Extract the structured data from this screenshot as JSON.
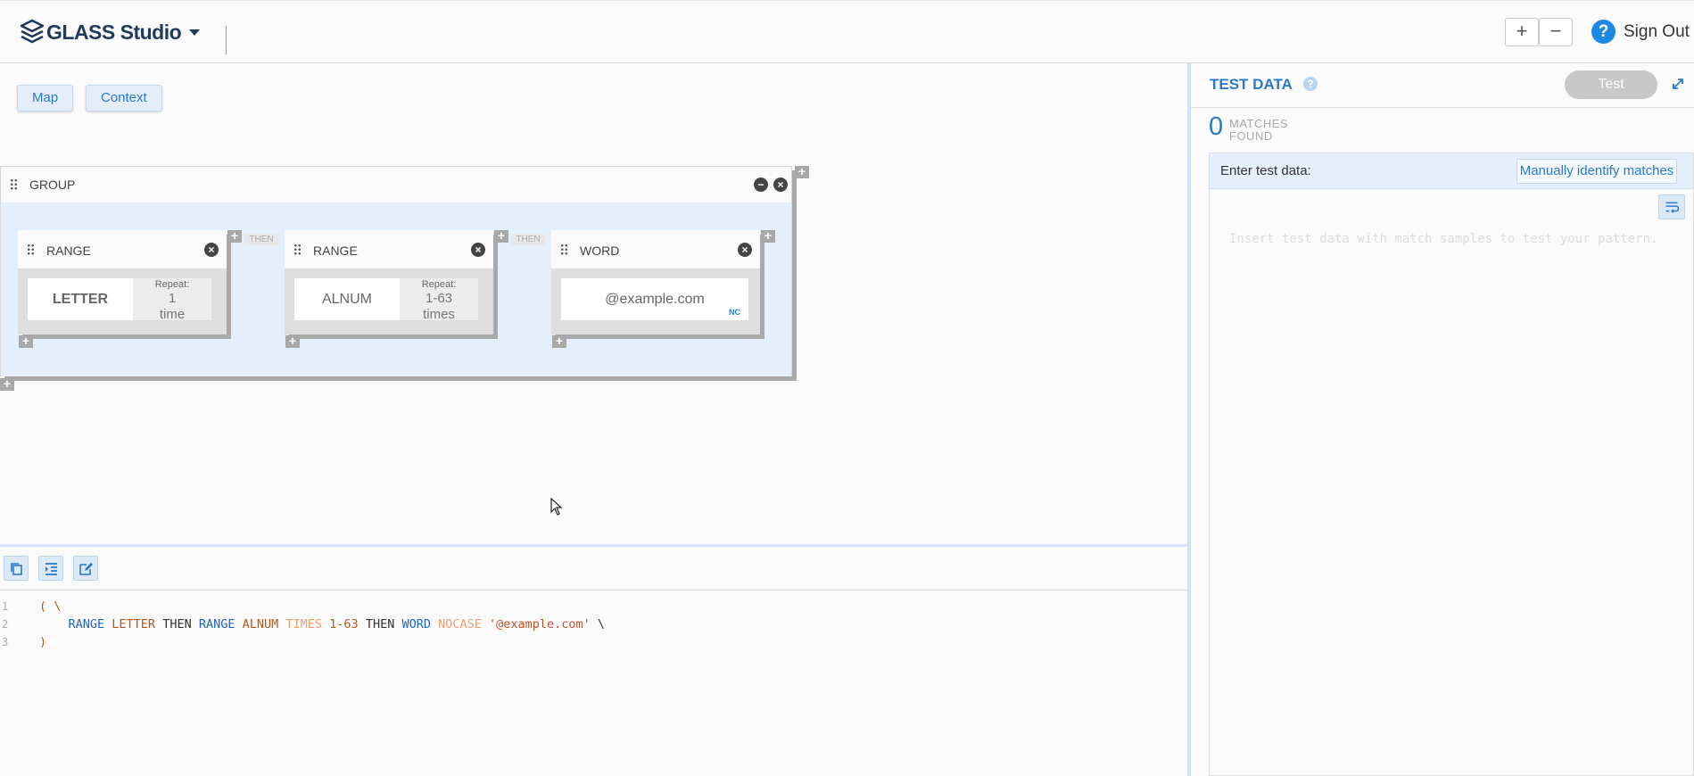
{
  "app": {
    "brand_name": "GLASS Studio",
    "zoom_in_label": "+",
    "zoom_out_label": "−",
    "help_label": "?",
    "sign_out_label": "Sign Out"
  },
  "canvas_toolbar": {
    "map_label": "Map",
    "context_label": "Context"
  },
  "pattern": {
    "group": {
      "label": "GROUP"
    },
    "nodes": [
      {
        "type": "RANGE",
        "value": "LETTER",
        "repeat_label": "Repeat:",
        "repeat_value": "1 time"
      },
      {
        "type": "RANGE",
        "value": "ALNUM",
        "repeat_label": "Repeat:",
        "repeat_value": "1-63 times"
      },
      {
        "type": "WORD",
        "value": "@example.com",
        "flag": "NC"
      }
    ],
    "connector_label": "THEN"
  },
  "code": {
    "lines": [
      {
        "num": "1",
        "tokens": [
          {
            "t": "( \\",
            "c": "kw-or"
          }
        ]
      },
      {
        "num": "2",
        "tokens": [
          {
            "t": "    RANGE ",
            "c": "kw-blue"
          },
          {
            "t": "LETTER ",
            "c": "kw-or"
          },
          {
            "t": "THEN ",
            "c": "kw-dark"
          },
          {
            "t": "RANGE ",
            "c": "kw-blue"
          },
          {
            "t": "ALNUM ",
            "c": "kw-or"
          },
          {
            "t": "TIMES ",
            "c": "kw-light"
          },
          {
            "t": "1-63 ",
            "c": "kw-or"
          },
          {
            "t": "THEN ",
            "c": "kw-dark"
          },
          {
            "t": "WORD ",
            "c": "kw-blue"
          },
          {
            "t": "NOCASE ",
            "c": "kw-light"
          },
          {
            "t": "'@example.com' ",
            "c": "kw-str"
          },
          {
            "t": "\\",
            "c": "kw-dark"
          }
        ]
      },
      {
        "num": "3",
        "tokens": [
          {
            "t": ")",
            "c": "kw-or"
          }
        ]
      }
    ]
  },
  "test_data": {
    "title": "TEST DATA",
    "test_button": "Test",
    "matches_count": "0",
    "matches_line1": "MATCHES",
    "matches_line2": "FOUND",
    "enter_label": "Enter test data:",
    "manual_button": "Manually identify matches",
    "placeholder": "Insert test data with match samples to test your pattern."
  },
  "colors": {
    "accent": "#2a7ac8",
    "brand": "#1e3a5c",
    "group_body": "#e4effb"
  }
}
